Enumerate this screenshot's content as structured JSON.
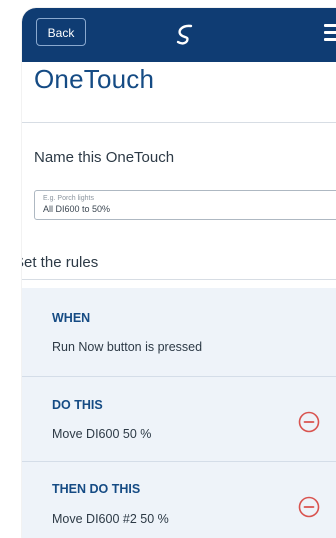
{
  "header": {
    "back_label": "Back",
    "logo_icon": "brand-swirl-icon",
    "menu_icon": "hamburger-menu-icon",
    "bar_color": "#0f3c73"
  },
  "page": {
    "title": "OneTouch"
  },
  "name_section": {
    "heading": "Name this OneTouch",
    "input_placeholder": "E.g. Porch lights",
    "input_value": "All DI600 to 50%"
  },
  "rules_section": {
    "heading": "Set the rules",
    "when": {
      "label": "WHEN",
      "text": "Run Now button is pressed"
    },
    "do_this": {
      "label": "DO THIS",
      "text": "Move DI600 50 %",
      "remove_icon": "minus-circle-icon"
    },
    "then_do_this": {
      "label": "THEN DO THIS",
      "text": "Move DI600 #2 50 %",
      "remove_icon": "minus-circle-icon"
    }
  },
  "colors": {
    "accent": "#154b84",
    "remove": "#d9534f",
    "panel": "#eef3f9"
  }
}
